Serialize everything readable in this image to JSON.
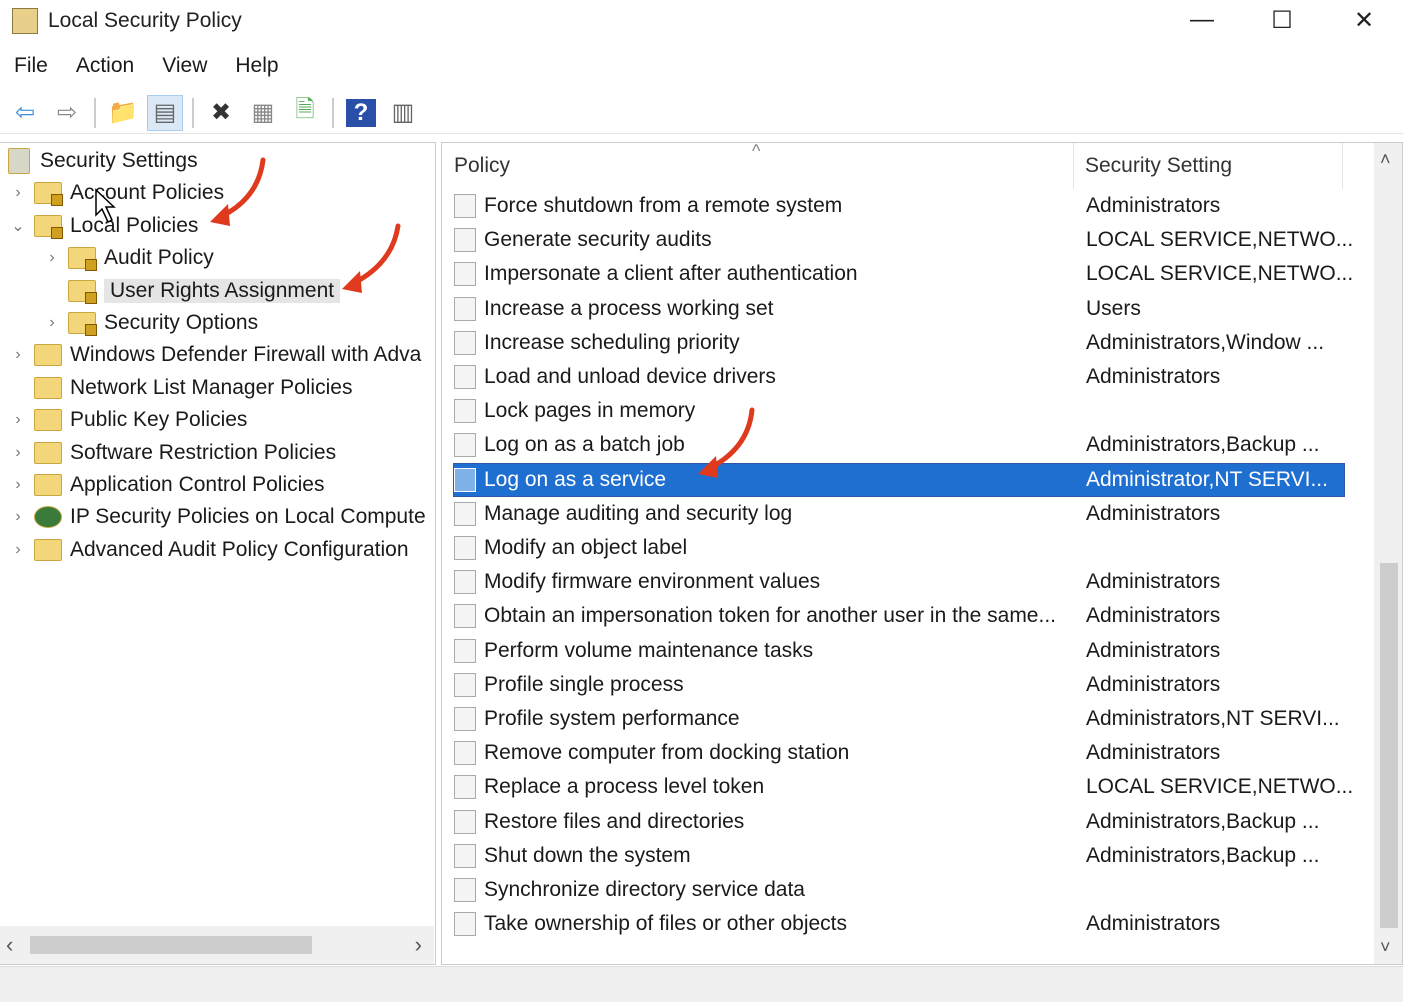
{
  "window": {
    "title": "Local Security Policy",
    "minimize": "—",
    "maximize": "☐",
    "close": "✕"
  },
  "menu": [
    "File",
    "Action",
    "View",
    "Help"
  ],
  "toolbar": [
    {
      "icon": "back-arrow-icon",
      "glyph": "⇦",
      "color": "#3d8fd6"
    },
    {
      "icon": "forward-arrow-icon",
      "glyph": "⇨",
      "color": "#888"
    },
    {
      "icon": "up-folder-icon",
      "glyph": "📁",
      "color": "#c9a640"
    },
    {
      "icon": "show-hide-tree-icon",
      "glyph": "▤",
      "color": "#666",
      "active": true
    },
    {
      "icon": "delete-icon",
      "glyph": "✖",
      "color": "#333"
    },
    {
      "icon": "properties-icon",
      "glyph": "▦",
      "color": "#888"
    },
    {
      "icon": "export-list-icon",
      "glyph": "🗎",
      "color": "#5a5"
    },
    {
      "icon": "help-icon",
      "glyph": "?",
      "color": "#fff",
      "bg": "#2a4fa8"
    },
    {
      "icon": "show-action-pane-icon",
      "glyph": "▥",
      "color": "#666"
    }
  ],
  "tree": [
    {
      "label": "Security Settings",
      "level": 0,
      "chev": "",
      "icon": "root"
    },
    {
      "label": "Account Policies",
      "level": 1,
      "chev": "›",
      "icon": "lock"
    },
    {
      "label": "Local Policies",
      "level": 1,
      "chev": "⌄",
      "icon": "lock"
    },
    {
      "label": "Audit Policy",
      "level": 2,
      "chev": "›",
      "icon": "lock"
    },
    {
      "label": "User Rights Assignment",
      "level": 2,
      "chev": "",
      "icon": "lock",
      "selected": true
    },
    {
      "label": "Security Options",
      "level": 2,
      "chev": "›",
      "icon": "lock"
    },
    {
      "label": "Windows Defender Firewall with Adva",
      "level": 1,
      "chev": "›",
      "icon": "folder"
    },
    {
      "label": "Network List Manager Policies",
      "level": 1,
      "chev": "",
      "icon": "folder"
    },
    {
      "label": "Public Key Policies",
      "level": 1,
      "chev": "›",
      "icon": "folder"
    },
    {
      "label": "Software Restriction Policies",
      "level": 1,
      "chev": "›",
      "icon": "folder"
    },
    {
      "label": "Application Control Policies",
      "level": 1,
      "chev": "›",
      "icon": "folder"
    },
    {
      "label": "IP Security Policies on Local Compute",
      "level": 1,
      "chev": "›",
      "icon": "ipsec"
    },
    {
      "label": "Advanced Audit Policy Configuration",
      "level": 1,
      "chev": "›",
      "icon": "folder"
    }
  ],
  "list": {
    "columns": [
      "Policy",
      "Security Setting"
    ],
    "sort_indicator": "^",
    "rows": [
      [
        "Force shutdown from a remote system",
        "Administrators"
      ],
      [
        "Generate security audits",
        "LOCAL SERVICE,NETWO..."
      ],
      [
        "Impersonate a client after authentication",
        "LOCAL SERVICE,NETWO..."
      ],
      [
        "Increase a process working set",
        "Users"
      ],
      [
        "Increase scheduling priority",
        "Administrators,Window ..."
      ],
      [
        "Load and unload device drivers",
        "Administrators"
      ],
      [
        "Lock pages in memory",
        ""
      ],
      [
        "Log on as a batch job",
        "Administrators,Backup ..."
      ],
      [
        "Log on as a service",
        "Administrator,NT SERVI..."
      ],
      [
        "Manage auditing and security log",
        "Administrators"
      ],
      [
        "Modify an object label",
        ""
      ],
      [
        "Modify firmware environment values",
        "Administrators"
      ],
      [
        "Obtain an impersonation token for another user in the same...",
        "Administrators"
      ],
      [
        "Perform volume maintenance tasks",
        "Administrators"
      ],
      [
        "Profile single process",
        "Administrators"
      ],
      [
        "Profile system performance",
        "Administrators,NT SERVI..."
      ],
      [
        "Remove computer from docking station",
        "Administrators"
      ],
      [
        "Replace a process level token",
        "LOCAL SERVICE,NETWO..."
      ],
      [
        "Restore files and directories",
        "Administrators,Backup ..."
      ],
      [
        "Shut down the system",
        "Administrators,Backup ..."
      ],
      [
        "Synchronize directory service data",
        ""
      ],
      [
        "Take ownership of files or other objects",
        "Administrators"
      ]
    ],
    "selected_index": 8
  },
  "scroll": {
    "left": "‹",
    "right": "›",
    "up": "˄",
    "down": "˅"
  },
  "colors": {
    "selection": "#1f6fd0",
    "annotation_arrow": "#e03a1e"
  }
}
